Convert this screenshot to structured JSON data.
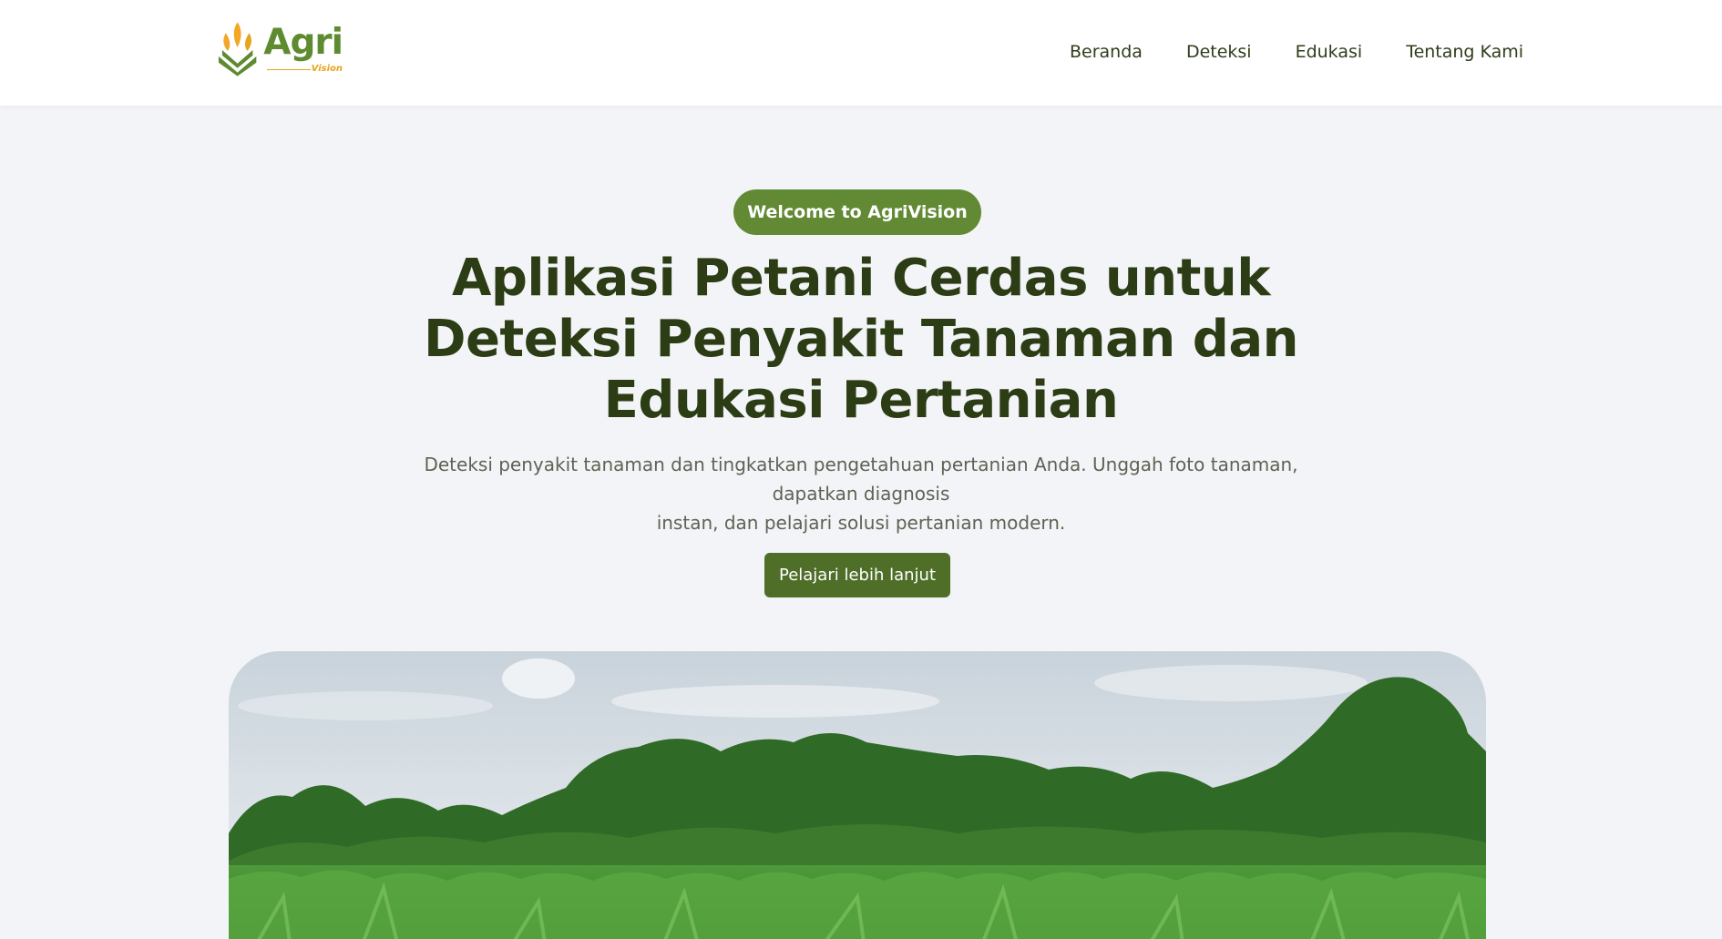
{
  "logo": {
    "brand": "Agri",
    "tagline": "Vision",
    "icon": "wheat-leaf-icon",
    "colors": {
      "green": "#5f8b30",
      "gold": "#e5a51d"
    }
  },
  "nav": {
    "items": [
      {
        "label": "Beranda"
      },
      {
        "label": "Deteksi"
      },
      {
        "label": "Edukasi"
      },
      {
        "label": "Tentang Kami"
      }
    ]
  },
  "hero": {
    "badge": "Welcome to AgriVision",
    "title_lines": [
      "Aplikasi Petani Cerdas untuk",
      "Deteksi Penyakit Tanaman dan",
      "Edukasi Pertanian"
    ],
    "description_lines": [
      "Deteksi penyakit tanaman dan tingkatkan pengetahuan pertanian Anda. Unggah foto tanaman, dapatkan diagnosis",
      "instan, dan pelajari solusi pertanian modern."
    ],
    "cta_label": "Pelajari lebih lanjut",
    "image": "cornfield-landscape-photo"
  },
  "colors": {
    "accent": "#628a34",
    "cta": "#4f6f29",
    "heading": "#2c3d15",
    "background": "#f3f4f7"
  }
}
